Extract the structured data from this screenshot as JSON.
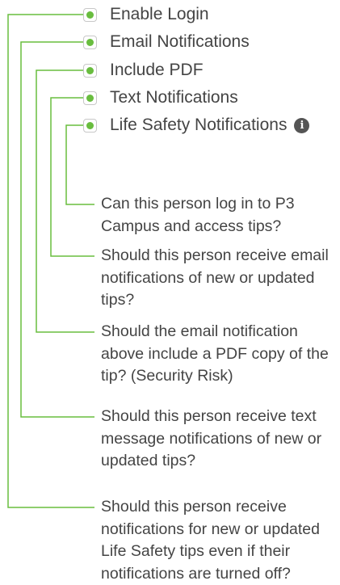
{
  "colors": {
    "connector": "#69bd3f",
    "checkbox_dot": "#69bd3f",
    "text": "#444444",
    "info_icon": "#555555"
  },
  "options": [
    {
      "label": "Enable Login",
      "checked": true
    },
    {
      "label": "Email Notifications",
      "checked": true
    },
    {
      "label": "Include PDF",
      "checked": true
    },
    {
      "label": "Text Notifications",
      "checked": true
    },
    {
      "label": "Life Safety Notifications",
      "checked": true,
      "icon": "info-icon",
      "icon_glyph": "i"
    }
  ],
  "descriptions": [
    "Can this person log in to P3 Campus and access tips?",
    "Should this person receive email notifications of new or updated tips?",
    "Should the email notification above include a PDF copy of the tip? (Security Risk)",
    "Should this person receive text message notifications of new or updated tips?",
    "Should this person receive notifications for new or updated Life Safety tips even if their notifications are turned off?"
  ]
}
